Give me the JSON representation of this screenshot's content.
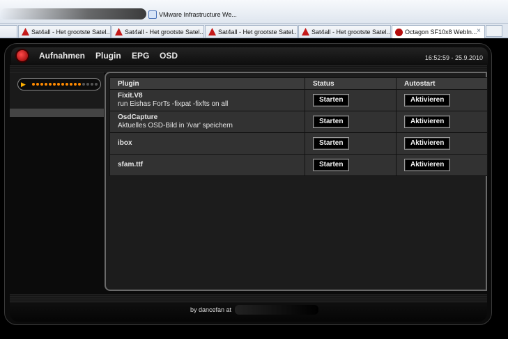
{
  "browser": {
    "bookmark_label": "VMware Infrastructure We...",
    "tabs": [
      {
        "label": "Sat4all - Het grootste Satel..."
      },
      {
        "label": "Sat4all - Het grootste Satel..."
      },
      {
        "label": "Sat4all - Het grootste Satel..."
      },
      {
        "label": "Sat4all - Het grootste Satel..."
      },
      {
        "label": "Octagon SF10x8 WebIn...",
        "active": true
      }
    ],
    "close_glyph": "×"
  },
  "nav": {
    "items": [
      "Aufnahmen",
      "Plugin",
      "EPG",
      "OSD"
    ],
    "datetime": "16:52:59 - 25.9.2010"
  },
  "volume": {
    "level_fraction": 0.75,
    "icon": "speaker-icon"
  },
  "table": {
    "headers": [
      "Plugin",
      "Status",
      "Autostart"
    ],
    "rows": [
      {
        "name": "Fixit.V8",
        "description": "run Eishas ForTs -fixpat -fixfts on all",
        "status_button": "Starten",
        "autostart_button": "Aktivieren"
      },
      {
        "name": "OsdCapture",
        "description": "Aktuelles OSD-Bild in '/var' speichern",
        "status_button": "Starten",
        "autostart_button": "Aktivieren"
      },
      {
        "name": "ibox",
        "description": "",
        "status_button": "Starten",
        "autostart_button": "Aktivieren"
      },
      {
        "name": "sfam.ttf",
        "description": "",
        "status_button": "Starten",
        "autostart_button": "Aktivieren"
      }
    ]
  },
  "footer": {
    "text": "by dancefan at"
  },
  "colors": {
    "accent": "#ff8a00",
    "logo": "#c41a1a"
  }
}
